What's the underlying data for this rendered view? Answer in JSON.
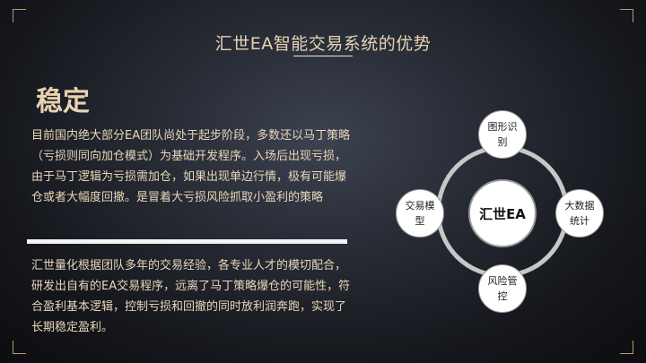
{
  "slide": {
    "title": "汇世EA智能交易系统的优势",
    "heading": "稳定",
    "paragraph1": "目前国内绝大部分EA团队尚处于起步阶段，多数还以马丁策略（亏损则同向加仓模式）为基础开发程序。入场后出现亏损，由于马丁逻辑为亏损需加仓，如果出现单边行情，极有可能爆仓或者大幅度回撤。是冒着大亏损风险抓取小盈利的策略",
    "paragraph2": "汇世量化根据团队多年的交易经验，各专业人才的模切配合，研发出自有的EA交易程序，远离了马丁策略爆仓的可能性，符合盈利基本逻辑，控制亏损和回撤的同时放利润奔跑，实现了长期稳定盈利。"
  },
  "diagram": {
    "center": "汇世EA",
    "top": "图形识别",
    "left": "交易模型",
    "right": "大数据统计",
    "bottom": "风险管控"
  }
}
